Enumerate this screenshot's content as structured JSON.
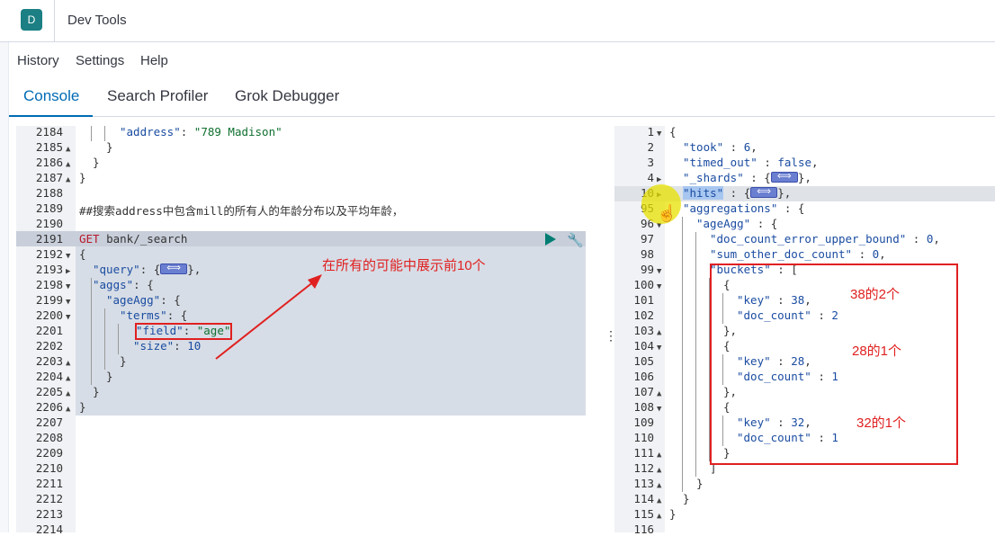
{
  "app": {
    "logo_letter": "D",
    "title": "Dev Tools"
  },
  "menu": [
    "History",
    "Settings",
    "Help"
  ],
  "tabs": [
    "Console",
    "Search Profiler",
    "Grok Debugger"
  ],
  "left_editor": {
    "line_numbers": [
      "2184",
      "2185",
      "2186",
      "2187",
      "2188",
      "2189",
      "2190",
      "2191",
      "2192",
      "2193",
      "2198",
      "2199",
      "2200",
      "2201",
      "2202",
      "2203",
      "2204",
      "2205",
      "2206",
      "2207",
      "2208",
      "2209",
      "2210",
      "2211",
      "2212",
      "2213",
      "2214"
    ],
    "lines": [
      "\"address\": \"789 Madison\"",
      "}",
      "}",
      "}",
      "",
      "##搜索address中包含mill的所有人的年龄分布以及平均年龄，",
      "",
      "GET bank/_search",
      "{",
      "\"query\": {",
      "\"aggs\": {",
      "\"ageAgg\": {",
      "\"terms\": {",
      "\"field\": \"age\"",
      "\"size\": 10",
      "}",
      "}",
      "}",
      "}",
      "",
      "",
      "",
      "",
      "",
      "",
      "",
      ""
    ]
  },
  "right_editor": {
    "line_numbers": [
      "1",
      "2",
      "3",
      "4",
      "10",
      "95",
      "96",
      "97",
      "98",
      "99",
      "100",
      "101",
      "102",
      "103",
      "104",
      "105",
      "106",
      "107",
      "108",
      "109",
      "110",
      "111",
      "112",
      "113",
      "114",
      "115",
      "116"
    ],
    "lines": [
      "{",
      "\"took\" : 6,",
      "\"timed_out\" : false,",
      "\"_shards\" : {",
      "\"hits\" : {",
      "\"aggregations\" : {",
      "\"ageAgg\" : {",
      "\"doc_count_error_upper_bound\" : 0,",
      "\"sum_other_doc_count\" : 0,",
      "\"buckets\" : [",
      "{",
      "\"key\" : 38,",
      "\"doc_count\" : 2",
      "},",
      "{",
      "\"key\" : 28,",
      "\"doc_count\" : 1",
      "},",
      "{",
      "\"key\" : 32,",
      "\"doc_count\" : 1",
      "}",
      "]",
      "}",
      "}",
      "}",
      ""
    ]
  },
  "annotations": {
    "arrow_note": "在所有的可能中展示前10个",
    "bucket1": "38的2个",
    "bucket2": "28的1个",
    "bucket3": "32的1个"
  },
  "colors": {
    "accent": "#006bb4",
    "annotation": "#e02020",
    "logo": "#1b7f83"
  }
}
